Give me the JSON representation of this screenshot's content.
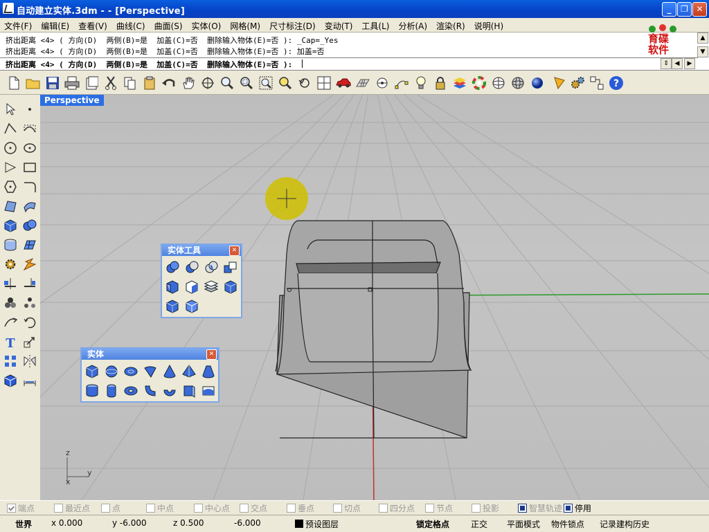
{
  "window": {
    "title": "自动建立实体.3dm -  - [Perspective]"
  },
  "menu": [
    "文件(F)",
    "编辑(E)",
    "查看(V)",
    "曲线(C)",
    "曲面(S)",
    "实体(O)",
    "网格(M)",
    "尺寸标注(D)",
    "变动(T)",
    "工具(L)",
    "分析(A)",
    "渲染(R)",
    "说明(H)"
  ],
  "command": {
    "history": [
      "挤出距离 <4> ( 方向(D)  两侧(B)=是  加盖(C)=否  删除输入物体(E)=否 ): _Cap=_Yes",
      "挤出距离 <4> ( 方向(D)  两侧(B)=是  加盖(C)=否  删除输入物体(E)=否 ): 加盖=否"
    ],
    "prompt": "挤出距离 <4> ( 方向(D)  两侧(B)=是  加盖(C)=否  删除输入物体(E)=否 ):"
  },
  "logo": {
    "line1": "育碟",
    "line2": "软件"
  },
  "viewport": {
    "label": "Perspective",
    "axes": {
      "z": "z",
      "y": "y",
      "x": "x"
    }
  },
  "float_solid_tools": {
    "title": "实体工具"
  },
  "float_solid": {
    "title": "实体"
  },
  "osnaps": [
    {
      "label": "端点",
      "checked": true
    },
    {
      "label": "最近点",
      "checked": false
    },
    {
      "label": "点",
      "checked": false
    },
    {
      "label": "中点",
      "checked": false
    },
    {
      "label": "中心点",
      "checked": false
    },
    {
      "label": "交点",
      "checked": false
    },
    {
      "label": "垂点",
      "checked": false
    },
    {
      "label": "切点",
      "checked": false
    },
    {
      "label": "四分点",
      "checked": false
    },
    {
      "label": "节点",
      "checked": false
    },
    {
      "label": "投影",
      "checked": false
    },
    {
      "label": "智慧轨迹",
      "checked": true
    },
    {
      "label": "停用",
      "checked": true
    }
  ],
  "status": {
    "coord_system": "世界",
    "x": "x 0.000",
    "y": "y -6.000",
    "z": "z 0.500",
    "distance": "-6.000",
    "layer": "预设图层",
    "snap": "锁定格点",
    "ortho": "正交",
    "planar": "平面模式",
    "osnap": "物件锁点",
    "history": "记录建构历史"
  },
  "colors": {
    "title_bar": "#0a5fdf",
    "viewport_bg": "#c0c0c0",
    "x_axis": "#c03030",
    "y_axis": "#2a9a2a"
  }
}
